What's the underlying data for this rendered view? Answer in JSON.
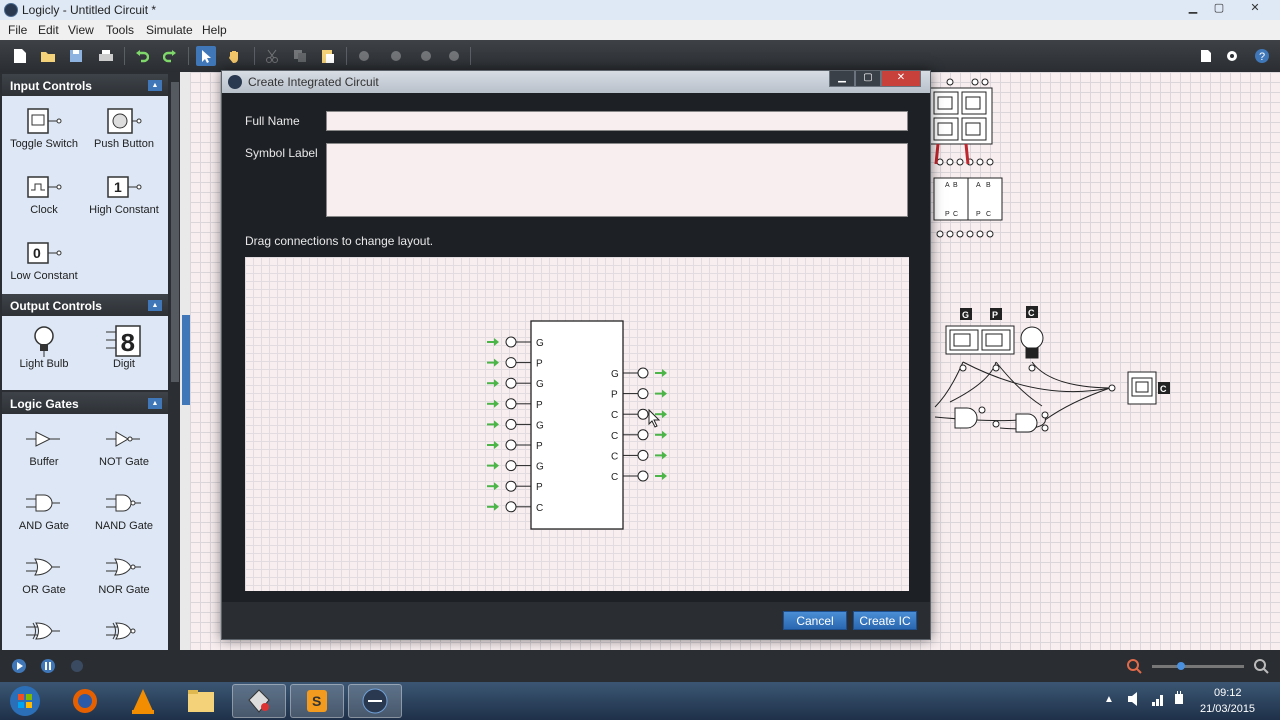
{
  "window": {
    "title": "Logicly - Untitled Circuit *",
    "min": "▁",
    "max": "▢",
    "close": "✕"
  },
  "menu": [
    "File",
    "Edit",
    "View",
    "Tools",
    "Simulate",
    "Help"
  ],
  "sidebar": {
    "input_controls": {
      "title": "Input Controls",
      "items": [
        "Toggle Switch",
        "Push Button",
        "Clock",
        "High Constant",
        "Low Constant"
      ]
    },
    "output_controls": {
      "title": "Output Controls",
      "items": [
        "Light Bulb",
        "Digit"
      ]
    },
    "logic_gates": {
      "title": "Logic Gates",
      "items": [
        "Buffer",
        "NOT Gate",
        "AND Gate",
        "NAND Gate",
        "OR Gate",
        "NOR Gate"
      ]
    }
  },
  "icon_glyphs": {
    "high_constant": "1",
    "low_constant": "0",
    "digit": "8"
  },
  "canvas_labels": {
    "g": "G",
    "p": "P",
    "c": "C",
    "c_out": "C",
    "ab_pc": [
      "A",
      "B",
      "P",
      "C",
      "A",
      "B",
      "P",
      "C"
    ]
  },
  "dialog": {
    "title": "Create Integrated Circuit",
    "full_name_label": "Full Name",
    "full_name_value": "",
    "symbol_label": "Symbol Label",
    "symbol_value": "",
    "instructions": "Drag connections to change layout.",
    "ic_inputs": [
      "G",
      "P",
      "G",
      "P",
      "G",
      "P",
      "G",
      "P",
      "C"
    ],
    "ic_outputs": [
      "G",
      "P",
      "C",
      "C",
      "C",
      "C"
    ],
    "cancel_label": "Cancel",
    "create_label": "Create IC"
  },
  "taskbar": {
    "time": "09:12",
    "date": "21/03/2015"
  },
  "colors": {
    "accent": "#3f77b8",
    "panel_bg": "#dde7f5",
    "dark": "#2b2f34",
    "arrow_green": "#4cb548"
  }
}
